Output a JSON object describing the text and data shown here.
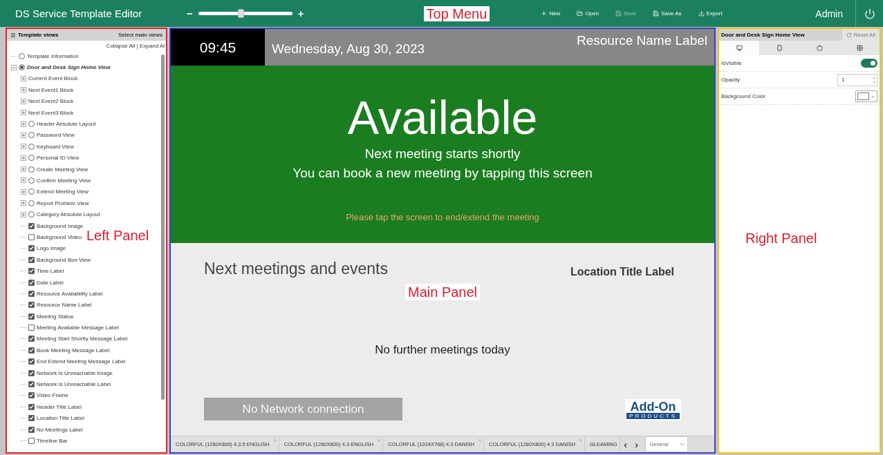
{
  "top_bar": {
    "title": "DS Service Template Editor",
    "zoom_minus": "−",
    "zoom_plus": "+",
    "zoom": {
      "level": 0.45
    },
    "annotation": "Top Menu",
    "actions": [
      {
        "kind": "new",
        "label": "New",
        "disabled": false
      },
      {
        "kind": "open",
        "label": "Open",
        "disabled": false
      },
      {
        "kind": "save",
        "label": "Save",
        "disabled": true
      },
      {
        "kind": "save",
        "label": "Save As",
        "disabled": false
      },
      {
        "kind": "export",
        "label": "Export",
        "disabled": false
      }
    ],
    "user": "Admin"
  },
  "left_panel": {
    "title": "Template views",
    "select_link": "Select main views",
    "collapse": "Collapse All",
    "separator": "|",
    "expand": "Expand Al",
    "annotation": "Left Panel",
    "tree": [
      {
        "kind": "radio",
        "label": "Template Information",
        "selected": false,
        "expandable": false
      },
      {
        "kind": "radio",
        "label": "Door and Desk Sign Home View",
        "selected": true,
        "expandable": true,
        "children": [
          {
            "kind": "block",
            "label": "Current Event Block",
            "expandable": true
          },
          {
            "kind": "block",
            "label": "Next Event1 Block",
            "expandable": true
          },
          {
            "kind": "block",
            "label": "Next Event2 Block",
            "expandable": true
          },
          {
            "kind": "block",
            "label": "Next Event3 Block",
            "expandable": true
          },
          {
            "kind": "radio",
            "label": "Header Absolute Layout",
            "selected": false,
            "expandable": true
          },
          {
            "kind": "radio",
            "label": "Password View",
            "selected": false,
            "expandable": true
          },
          {
            "kind": "radio",
            "label": "Keyboard View",
            "selected": false,
            "expandable": true
          },
          {
            "kind": "radio",
            "label": "Personal ID View",
            "selected": false,
            "expandable": true
          },
          {
            "kind": "radio",
            "label": "Create Meeting View",
            "selected": false,
            "expandable": true
          },
          {
            "kind": "radio",
            "label": "Confirm Meeting View",
            "selected": false,
            "expandable": true
          },
          {
            "kind": "radio",
            "label": "Extend Meeting View",
            "selected": false,
            "expandable": true
          },
          {
            "kind": "radio",
            "label": "Report Problem View",
            "selected": false,
            "expandable": true
          },
          {
            "kind": "radio",
            "label": "Category Absolute Layout",
            "selected": false,
            "expandable": true
          },
          {
            "kind": "check",
            "label": "Background Image",
            "checked": true
          },
          {
            "kind": "check",
            "label": "Background Video",
            "checked": false
          },
          {
            "kind": "check",
            "label": "Logo Image",
            "checked": true
          },
          {
            "kind": "check",
            "label": "Background Box View",
            "checked": true
          },
          {
            "kind": "check",
            "label": "Time Label",
            "checked": true
          },
          {
            "kind": "check",
            "label": "Date Label",
            "checked": true
          },
          {
            "kind": "check",
            "label": "Resource Availability Label",
            "checked": true
          },
          {
            "kind": "check",
            "label": "Resource Name Label",
            "checked": true
          },
          {
            "kind": "check",
            "label": "Meeting Status",
            "checked": true
          },
          {
            "kind": "check",
            "label": "Meeting Available Message Label",
            "checked": false
          },
          {
            "kind": "check",
            "label": "Meeting Start Shortly Message Label",
            "checked": true
          },
          {
            "kind": "check",
            "label": "Book Meeting Message Label",
            "checked": true
          },
          {
            "kind": "check",
            "label": "End Extend Meeting Message Label",
            "checked": true
          },
          {
            "kind": "check",
            "label": "Network Is Unreachable Image",
            "checked": true
          },
          {
            "kind": "check",
            "label": "Network Is Unreachable Label",
            "checked": true
          },
          {
            "kind": "check",
            "label": "Video Frame",
            "checked": true
          },
          {
            "kind": "check",
            "label": "Header Title Label",
            "checked": true
          },
          {
            "kind": "check",
            "label": "Location Title Label",
            "checked": true
          },
          {
            "kind": "check",
            "label": "No Meetings Label",
            "checked": true
          },
          {
            "kind": "check",
            "label": "Timeline Bar",
            "checked": false
          }
        ]
      }
    ]
  },
  "main_panel": {
    "time": "09:45",
    "date": "Wednesday, Aug 30, 2023",
    "resource_name": "Resource Name Label",
    "status": "Available",
    "messages": [
      "Next meeting starts shortly",
      "You can book a new meeting by tapping this screen"
    ],
    "end_message": "Please tap the screen to end/extend the meeting",
    "next_title": "Next meetings and events",
    "location_title": "Location Title Label",
    "annotation": "Main Panel",
    "no_meetings": "No further meetings today",
    "network": "No Network connection",
    "logo": {
      "top": "Add-On",
      "bottom": "PRODUCTS"
    },
    "template_tabs": [
      {
        "label": "COLORFUL (1280X800) 4.3.5 ENGLISH",
        "close": "×"
      },
      {
        "label": "COLORFUL (1280X800) 4.3 ENGLISH",
        "close": "×"
      },
      {
        "label": "COLORFUL (1024X768) 4.3 DANISH",
        "close": "×"
      },
      {
        "label": "COLORFUL (1280X800) 4.3 DANISH",
        "close": "×"
      },
      {
        "label": "GLEAMING"
      }
    ],
    "prev": "‹",
    "next": "›",
    "category": "General"
  },
  "right_panel": {
    "title": "Door and Desk Sign Home View",
    "reset": "Reset All",
    "annotation": "Right Panel",
    "platform_tabs": [
      {
        "kind": "monitor",
        "selected": true
      },
      {
        "kind": "android",
        "selected": false
      },
      {
        "kind": "apple",
        "selected": false
      },
      {
        "kind": "windows",
        "selected": false
      }
    ],
    "properties": [
      {
        "kind": "toggle",
        "label": "IsVisible",
        "on": true
      },
      {
        "kind": "number",
        "label": "Opacity",
        "value": "1"
      },
      {
        "kind": "color",
        "label": "Background Color",
        "color": "#ffffff"
      }
    ]
  }
}
